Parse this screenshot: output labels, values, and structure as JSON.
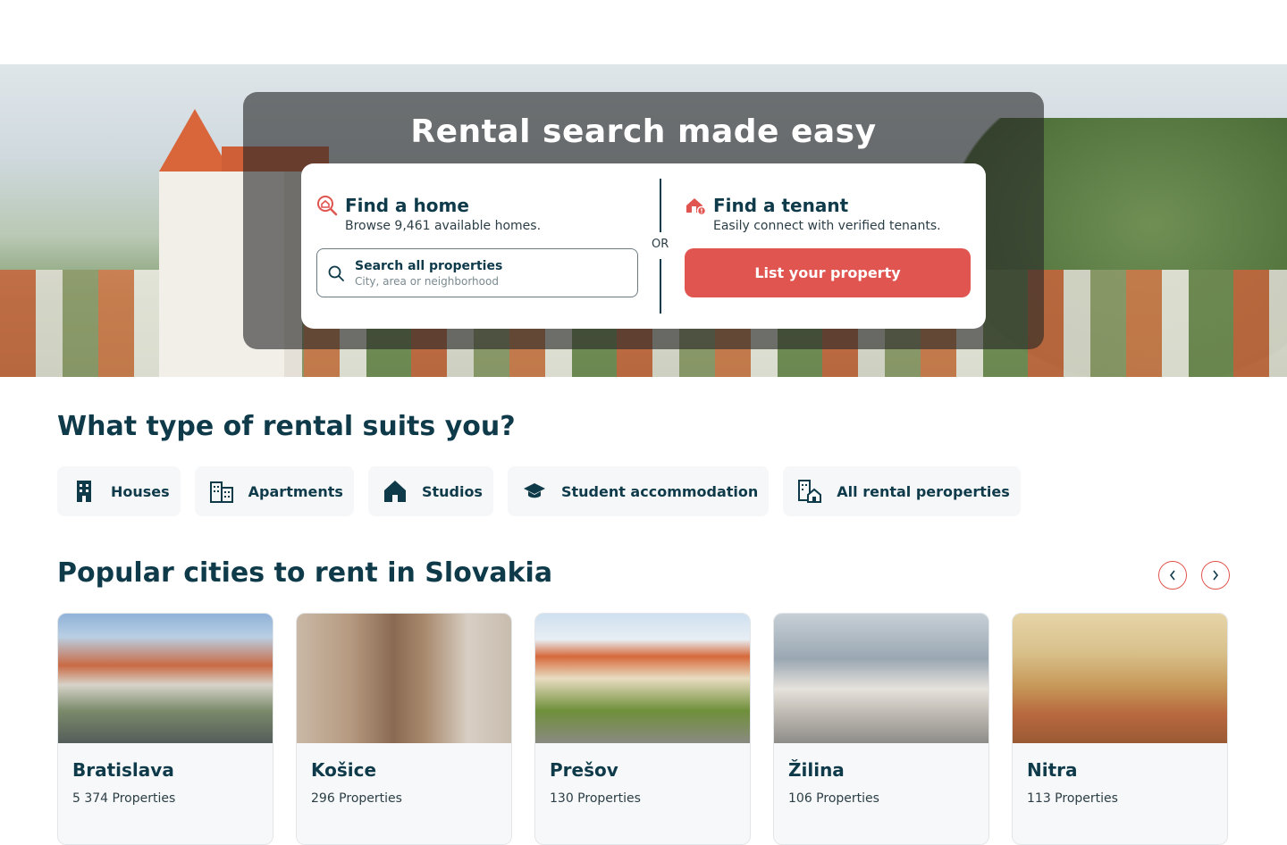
{
  "hero": {
    "title": "Rental search made easy",
    "find_home": {
      "title": "Find a home",
      "subtitle": "Browse 9,461 available homes.",
      "search_title": "Search all properties",
      "search_placeholder": "City, area or neighborhood"
    },
    "or_label": "OR",
    "find_tenant": {
      "title": "Find a tenant",
      "subtitle": "Easily connect with verified tenants.",
      "button_label": "List your property"
    }
  },
  "types_section": {
    "title": "What type of rental suits you?",
    "items": [
      {
        "label": "Houses",
        "icon": "building-icon"
      },
      {
        "label": "Apartments",
        "icon": "apartments-icon"
      },
      {
        "label": "Studios",
        "icon": "house-icon"
      },
      {
        "label": "Student accommodation",
        "icon": "graduation-cap-icon"
      },
      {
        "label": "All rental peroperties",
        "icon": "buildings-home-icon"
      }
    ]
  },
  "cities_section": {
    "title": "Popular cities to rent in Slovakia",
    "cities": [
      {
        "name": "Bratislava",
        "count": "5 374 Properties"
      },
      {
        "name": "Košice",
        "count": "296 Properties"
      },
      {
        "name": "Prešov",
        "count": "130 Properties"
      },
      {
        "name": "Žilina",
        "count": "106 Properties"
      },
      {
        "name": "Nitra",
        "count": "113 Properties"
      }
    ]
  },
  "colors": {
    "primary": "#0e3a4a",
    "accent": "#e05550"
  }
}
